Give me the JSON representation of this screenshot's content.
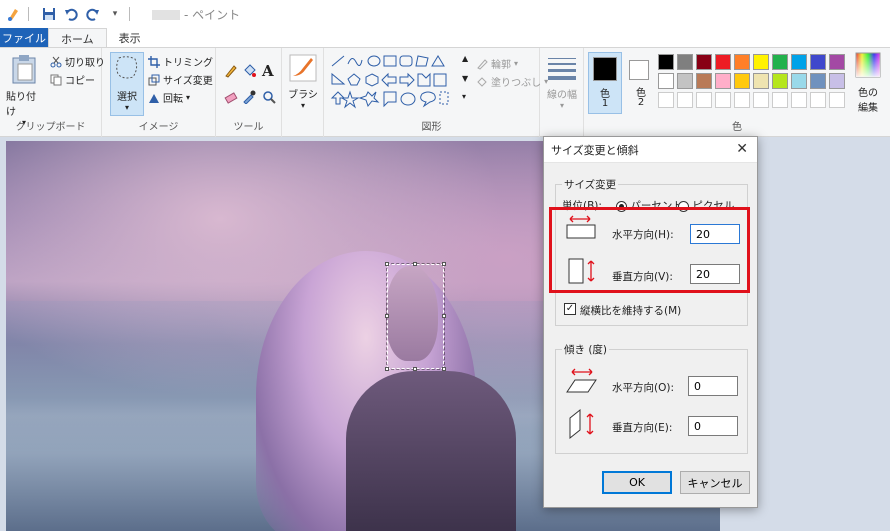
{
  "window": {
    "title": "- ペイント"
  },
  "tabs": {
    "file": "ファイル",
    "home": "ホーム",
    "view": "表示"
  },
  "ribbon": {
    "clipboard": {
      "paste": "貼り付け",
      "cut": "切り取り",
      "copy": "コピー",
      "label": "クリップボード"
    },
    "image": {
      "select": "選択",
      "crop": "トリミング",
      "resize": "サイズ変更",
      "rotate": "回転",
      "label": "イメージ"
    },
    "tools": {
      "label": "ツール"
    },
    "brushes": {
      "label": "ブラシ"
    },
    "shapes": {
      "outline": "輪郭",
      "fill": "塗りつぶし",
      "label": "図形"
    },
    "size": {
      "label": "線の幅"
    },
    "colors": {
      "color1": "色",
      "color1_num": "1",
      "color2": "色",
      "color2_num": "2",
      "edit": "色の",
      "edit2": "編集",
      "label": "色",
      "palette": [
        "#000000",
        "#7f7f7f",
        "#880015",
        "#ed1c24",
        "#ff7f27",
        "#fff200",
        "#22b14c",
        "#00a2e8",
        "#3f48cc",
        "#a349a4",
        "#ffffff",
        "#c3c3c3",
        "#b97a57",
        "#ffaec9",
        "#ffc90e",
        "#efe4b0",
        "#b5e61d",
        "#99d9ea",
        "#7092be",
        "#c8bfe7"
      ]
    }
  },
  "dialog": {
    "title": "サイズ変更と傾斜",
    "resize_group": "サイズ変更",
    "unit_label": "単位(B):",
    "unit_percent": "パーセント",
    "unit_pixel": "ピクセル",
    "horizontal_label": "水平方向(H):",
    "horizontal_value": "20",
    "vertical_label": "垂直方向(V):",
    "vertical_value": "20",
    "keep_ratio": "縦横比を維持する(M)",
    "skew_group": "傾き (度)",
    "skew_h_label": "水平方向(O):",
    "skew_h_value": "0",
    "skew_v_label": "垂直方向(E):",
    "skew_v_value": "0",
    "ok": "OK",
    "cancel": "キャンセル"
  },
  "colors": {
    "accent": "#1e63b8",
    "highlight": "#e0111b",
    "arrow": "#e0111b"
  }
}
